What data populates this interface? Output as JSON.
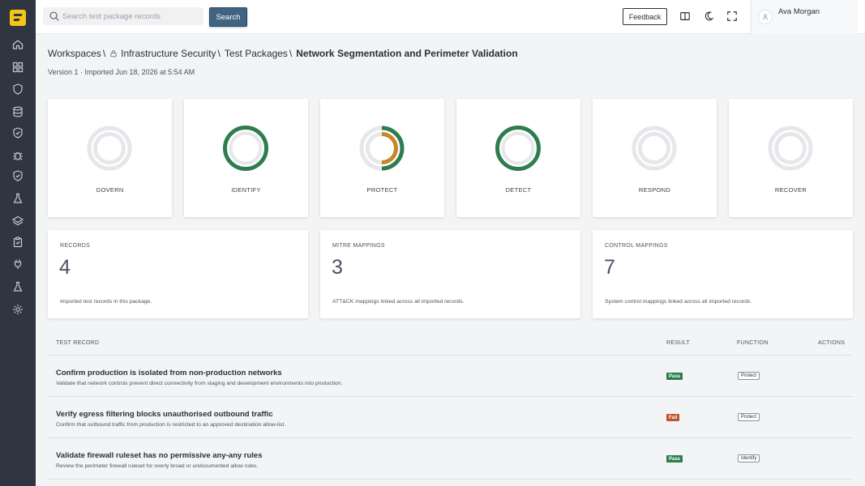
{
  "topbar": {
    "search_placeholder": "Search test package records",
    "search_button": "Search",
    "feedback_button": "Feedback",
    "user_name": "Ava Morgan"
  },
  "sidebar": {
    "items": [
      {
        "icon": "home-icon"
      },
      {
        "icon": "grid-icon"
      },
      {
        "icon": "shield-icon"
      },
      {
        "icon": "database-icon"
      },
      {
        "icon": "shield-check-icon"
      },
      {
        "icon": "bug-icon"
      },
      {
        "icon": "shield-check-icon"
      },
      {
        "icon": "flask-icon"
      },
      {
        "icon": "layers-icon"
      },
      {
        "icon": "clipboard-icon"
      },
      {
        "icon": "plug-icon"
      },
      {
        "icon": "flask-icon"
      },
      {
        "icon": "settings-icon"
      }
    ]
  },
  "breadcrumb": {
    "items": [
      "Workspaces",
      "Infrastructure Security",
      "Test Packages"
    ],
    "separator": "\\",
    "current": "Network Segmentation and Perimeter Validation"
  },
  "subtitle": "Version 1 · Imported Jun 18, 2026 at 5:54 AM",
  "functions": [
    {
      "label": "GOVERN",
      "pass": 0,
      "fail": 0
    },
    {
      "label": "IDENTIFY",
      "pass": 1,
      "fail": 0
    },
    {
      "label": "PROTECT",
      "pass": 1,
      "fail": 1
    },
    {
      "label": "DETECT",
      "pass": 1,
      "fail": 0
    },
    {
      "label": "RESPOND",
      "pass": 0,
      "fail": 0
    },
    {
      "label": "RECOVER",
      "pass": 0,
      "fail": 0
    }
  ],
  "stats": [
    {
      "label": "RECORDS",
      "value": "4",
      "desc": "Imported test records in this package."
    },
    {
      "label": "MITRE MAPPINGS",
      "value": "3",
      "desc": "ATT&CK mappings linked across all imported records."
    },
    {
      "label": "CONTROL MAPPINGS",
      "value": "7",
      "desc": "System control mappings linked across all imported records."
    }
  ],
  "table": {
    "headers": {
      "record": "TEST RECORD",
      "result": "RESULT",
      "function": "FUNCTION",
      "actions": "ACTIONS"
    },
    "rows": [
      {
        "title": "Confirm production is isolated from non-production networks",
        "desc": "Validate that network controls prevent direct connectivity from staging and development environments into production.",
        "result": "Pass",
        "function": "Protect"
      },
      {
        "title": "Verify egress filtering blocks unauthorised outbound traffic",
        "desc": "Confirm that outbound traffic from production is restricted to an approved destination allow-list.",
        "result": "Fail",
        "function": "Protect"
      },
      {
        "title": "Validate firewall ruleset has no permissive any-any rules",
        "desc": "Review the perimeter firewall ruleset for overly broad or undocumented allow rules.",
        "result": "Pass",
        "function": "Identify"
      }
    ]
  },
  "colors": {
    "pass": "#2e7d4f",
    "fail": "#c0562a",
    "ring_empty": "#e6e7ea",
    "partial_fail": "#c7862a",
    "sidebar": "#2f3641",
    "accent": "#3f6380"
  }
}
